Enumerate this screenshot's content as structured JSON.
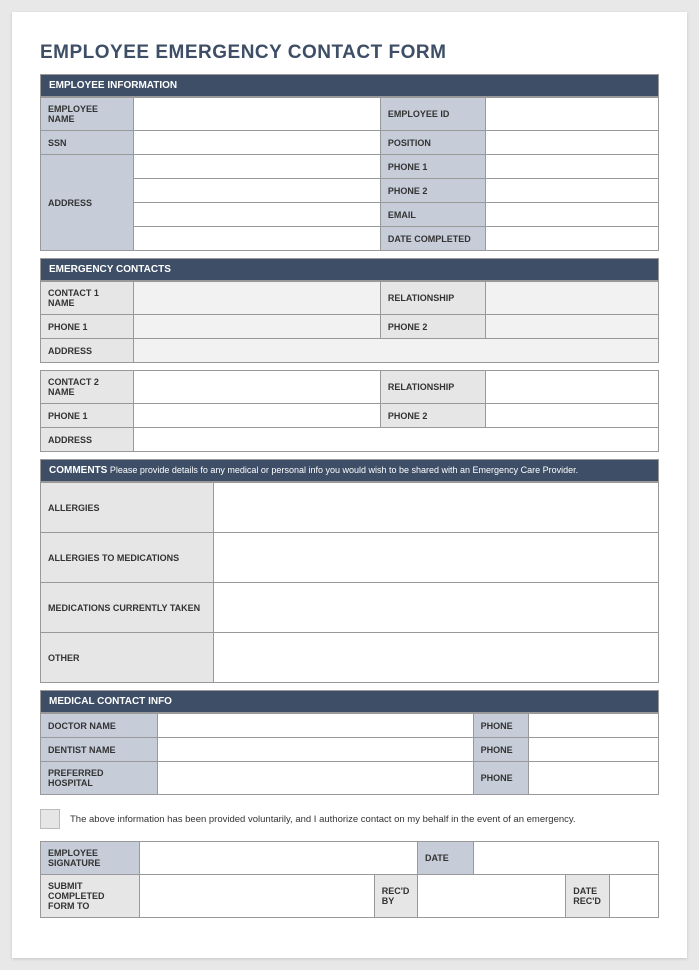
{
  "title": "EMPLOYEE EMERGENCY CONTACT FORM",
  "sections": {
    "employee_info": {
      "header": "EMPLOYEE INFORMATION",
      "fields": {
        "employee_name": "EMPLOYEE NAME",
        "employee_id": "EMPLOYEE ID",
        "ssn": "SSN",
        "position": "POSITION",
        "address": "ADDRESS",
        "phone1": "PHONE 1",
        "phone2": "PHONE 2",
        "email": "EMAIL",
        "date_completed": "DATE COMPLETED"
      }
    },
    "emergency_contacts": {
      "header": "EMERGENCY CONTACTS",
      "fields": {
        "contact1_name": "CONTACT 1 NAME",
        "relationship": "RELATIONSHIP",
        "phone1": "PHONE 1",
        "phone2": "PHONE 2",
        "address": "ADDRESS",
        "contact2_name": "CONTACT 2 NAME"
      }
    },
    "comments": {
      "header": "COMMENTS",
      "subtext": " Please provide details fo any medical or personal info you would wish to be shared with an Emergency Care Provider.",
      "fields": {
        "allergies": "ALLERGIES",
        "allergies_meds": "ALLERGIES TO MEDICATIONS",
        "meds_taken": "MEDICATIONS CURRENTLY TAKEN",
        "other": "OTHER"
      }
    },
    "medical": {
      "header": "MEDICAL CONTACT INFO",
      "fields": {
        "doctor_name": "DOCTOR NAME",
        "dentist_name": "DENTIST NAME",
        "preferred_hospital": "PREFERRED HOSPITAL",
        "phone": "PHONE"
      }
    },
    "auth": {
      "text": "The above information has been provided voluntarily, and I authorize contact on my behalf in the event of an emergency.",
      "fields": {
        "signature": "EMPLOYEE SIGNATURE",
        "date": "DATE",
        "submit_to": "SUBMIT COMPLETED FORM TO",
        "recd_by": "REC'D BY",
        "date_recd": "DATE REC'D"
      }
    }
  }
}
